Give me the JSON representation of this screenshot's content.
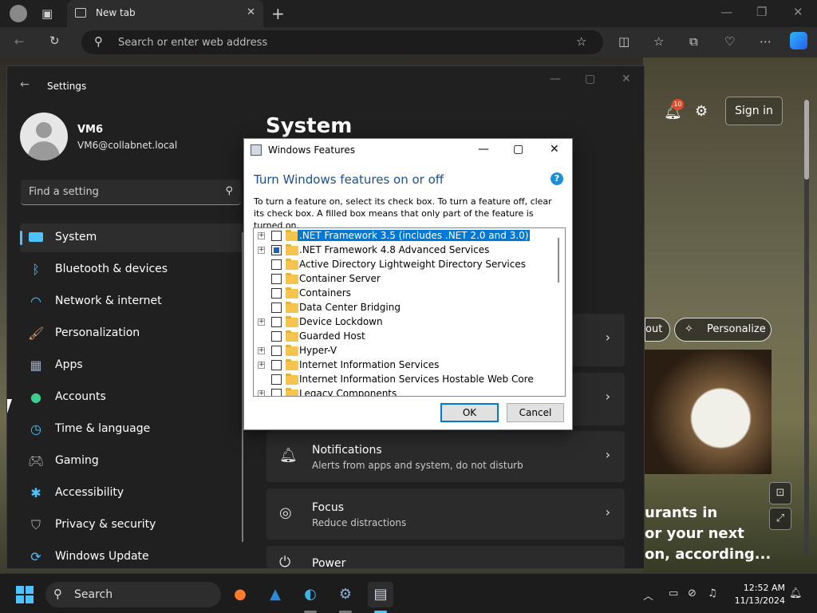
{
  "browser": {
    "tab_title": "New tab",
    "address_placeholder": "Search or enter web address",
    "tab_close": "✕",
    "new_tab": "+"
  },
  "webpage": {
    "sign_in": "Sign in",
    "notifications_badge": "10",
    "personalize": "Personalize",
    "out": "out",
    "headline": "urants in\nor your next\non, according..."
  },
  "settings": {
    "window_title": "Settings",
    "user_name": "VM6",
    "user_email": "VM6@collabnet.local",
    "search_placeholder": "Find a setting",
    "page_title": "System",
    "nav": [
      {
        "label": "System"
      },
      {
        "label": "Bluetooth & devices"
      },
      {
        "label": "Network & internet"
      },
      {
        "label": "Personalization"
      },
      {
        "label": "Apps"
      },
      {
        "label": "Accounts"
      },
      {
        "label": "Time & language"
      },
      {
        "label": "Gaming"
      },
      {
        "label": "Accessibility"
      },
      {
        "label": "Privacy & security"
      },
      {
        "label": "Windows Update"
      }
    ],
    "cards": [
      {
        "title": "Notifications",
        "subtitle": "Alerts from apps and system, do not disturb"
      },
      {
        "title": "Focus",
        "subtitle": "Reduce distractions"
      },
      {
        "title": "Power",
        "subtitle": ""
      }
    ]
  },
  "dialog": {
    "title": "Windows Features",
    "heading": "Turn Windows features on or off",
    "help": "?",
    "description": "To turn a feature on, select its check box. To turn a feature off, clear its check box. A filled box means that only part of the feature is turned on.",
    "features": [
      {
        "label": ".NET Framework 3.5 (includes .NET 2.0 and 3.0)",
        "expandable": true,
        "state": "off",
        "selected": true
      },
      {
        "label": ".NET Framework 4.8 Advanced Services",
        "expandable": true,
        "state": "partial",
        "selected": false
      },
      {
        "label": "Active Directory Lightweight Directory Services",
        "expandable": false,
        "state": "off",
        "selected": false
      },
      {
        "label": "Container Server",
        "expandable": false,
        "state": "off",
        "selected": false
      },
      {
        "label": "Containers",
        "expandable": false,
        "state": "off",
        "selected": false
      },
      {
        "label": "Data Center Bridging",
        "expandable": false,
        "state": "off",
        "selected": false
      },
      {
        "label": "Device Lockdown",
        "expandable": true,
        "state": "off",
        "selected": false
      },
      {
        "label": "Guarded Host",
        "expandable": false,
        "state": "off",
        "selected": false
      },
      {
        "label": "Hyper-V",
        "expandable": true,
        "state": "off",
        "selected": false
      },
      {
        "label": "Internet Information Services",
        "expandable": true,
        "state": "off",
        "selected": false
      },
      {
        "label": "Internet Information Services Hostable Web Core",
        "expandable": false,
        "state": "off",
        "selected": false
      },
      {
        "label": "Legacy Components",
        "expandable": true,
        "state": "off",
        "selected": false
      }
    ],
    "ok": "OK",
    "cancel": "Cancel"
  },
  "taskbar": {
    "search": "Search",
    "time": "12:52 AM",
    "date": "11/13/2024"
  },
  "colors": {
    "accent": "#4cc2ff",
    "selection": "#0078d7",
    "heading_blue": "#1a4e96"
  }
}
